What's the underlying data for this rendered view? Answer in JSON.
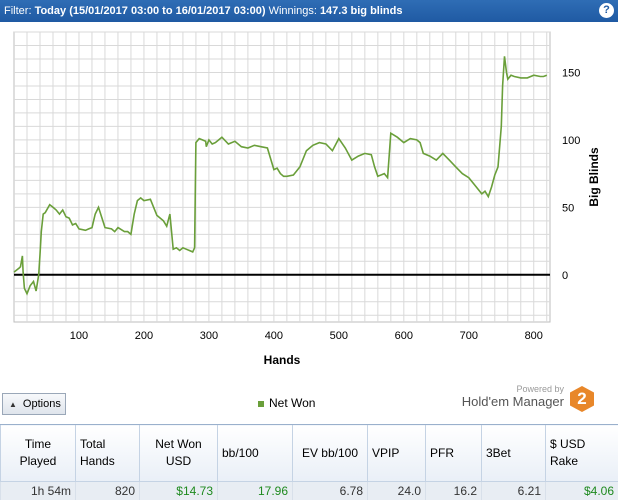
{
  "header": {
    "filter_label": "Filter:",
    "filter_value": "Today (15/01/2017 03:00 to 16/01/2017 03:00)",
    "winnings_label": "Winnings:",
    "winnings_value": "147.3 big blinds",
    "help_label": "?"
  },
  "toolbar": {
    "options_label": "Options",
    "legend_label": "Net Won",
    "powered_by": "Powered by",
    "brand_name": "Hold'em Manager",
    "brand_logo_text": "2"
  },
  "colors": {
    "line": "#6a9f3a",
    "zero_line": "#000000",
    "grid": "#d9d9d9",
    "header_bg": "#1f5aa3",
    "money": "#1f8a1f"
  },
  "stats": {
    "headers": [
      "Time Played",
      "Total Hands",
      "Net Won USD",
      "bb/100",
      "EV bb/100",
      "VPIP",
      "PFR",
      "3Bet",
      "$ USD Rake"
    ],
    "values": [
      "1h 54m",
      "820",
      "$14.73",
      "17.96",
      "6.78",
      "24.0",
      "16.2",
      "6.21",
      "$4.06"
    ]
  },
  "chart_data": {
    "type": "line",
    "xlabel": "Hands",
    "ylabel": "Big Blinds",
    "xlim": [
      0,
      825
    ],
    "ylim": [
      -35,
      180
    ],
    "x_ticks": [
      100,
      200,
      300,
      400,
      500,
      600,
      700,
      800
    ],
    "y_ticks": [
      0,
      50,
      100,
      150
    ],
    "grid": true,
    "legend": "bottom-center",
    "series": [
      {
        "name": "Net Won",
        "x": [
          0,
          8,
          10,
          13,
          14,
          16,
          20,
          25,
          30,
          34,
          38,
          40,
          42,
          45,
          48,
          55,
          60,
          65,
          70,
          75,
          80,
          85,
          90,
          95,
          100,
          110,
          115,
          120,
          125,
          130,
          140,
          150,
          155,
          160,
          170,
          175,
          180,
          185,
          190,
          195,
          200,
          210,
          220,
          230,
          235,
          240,
          245,
          250,
          255,
          260,
          265,
          270,
          275,
          278,
          280,
          285,
          290,
          295,
          296,
          300,
          305,
          310,
          320,
          330,
          340,
          350,
          360,
          370,
          380,
          390,
          400,
          405,
          410,
          415,
          420,
          430,
          440,
          450,
          460,
          470,
          480,
          490,
          500,
          510,
          520,
          530,
          540,
          550,
          555,
          560,
          570,
          575,
          580,
          590,
          600,
          610,
          620,
          625,
          630,
          640,
          650,
          660,
          670,
          680,
          690,
          700,
          710,
          715,
          720,
          725,
          730,
          735,
          740,
          745,
          750,
          752,
          755,
          758,
          760,
          765,
          770,
          780,
          790,
          800,
          810,
          815,
          820
        ],
        "y": [
          2,
          5,
          6,
          14,
          2,
          -10,
          -14,
          -8,
          -5,
          -12,
          0,
          15,
          32,
          45,
          46,
          52,
          50,
          48,
          45,
          48,
          43,
          42,
          37,
          38,
          34,
          33,
          34,
          35,
          45,
          50,
          35,
          34,
          32,
          35,
          32,
          32,
          30,
          45,
          55,
          57,
          55,
          56,
          44,
          40,
          36,
          45,
          19,
          20,
          18,
          20,
          19,
          18,
          17,
          20,
          98,
          101,
          100,
          99,
          95,
          100,
          97,
          98,
          102,
          97,
          99,
          95,
          94,
          96,
          95,
          94,
          78,
          79,
          75,
          73,
          73,
          74,
          80,
          92,
          96,
          98,
          97,
          92,
          101,
          94,
          85,
          88,
          90,
          89,
          80,
          73,
          75,
          72,
          105,
          102,
          98,
          101,
          100,
          98,
          90,
          88,
          85,
          90,
          85,
          80,
          75,
          72,
          66,
          63,
          60,
          62,
          58,
          65,
          74,
          80,
          110,
          140,
          162,
          150,
          145,
          148,
          147,
          146,
          146,
          148,
          147,
          147,
          148
        ]
      }
    ]
  }
}
